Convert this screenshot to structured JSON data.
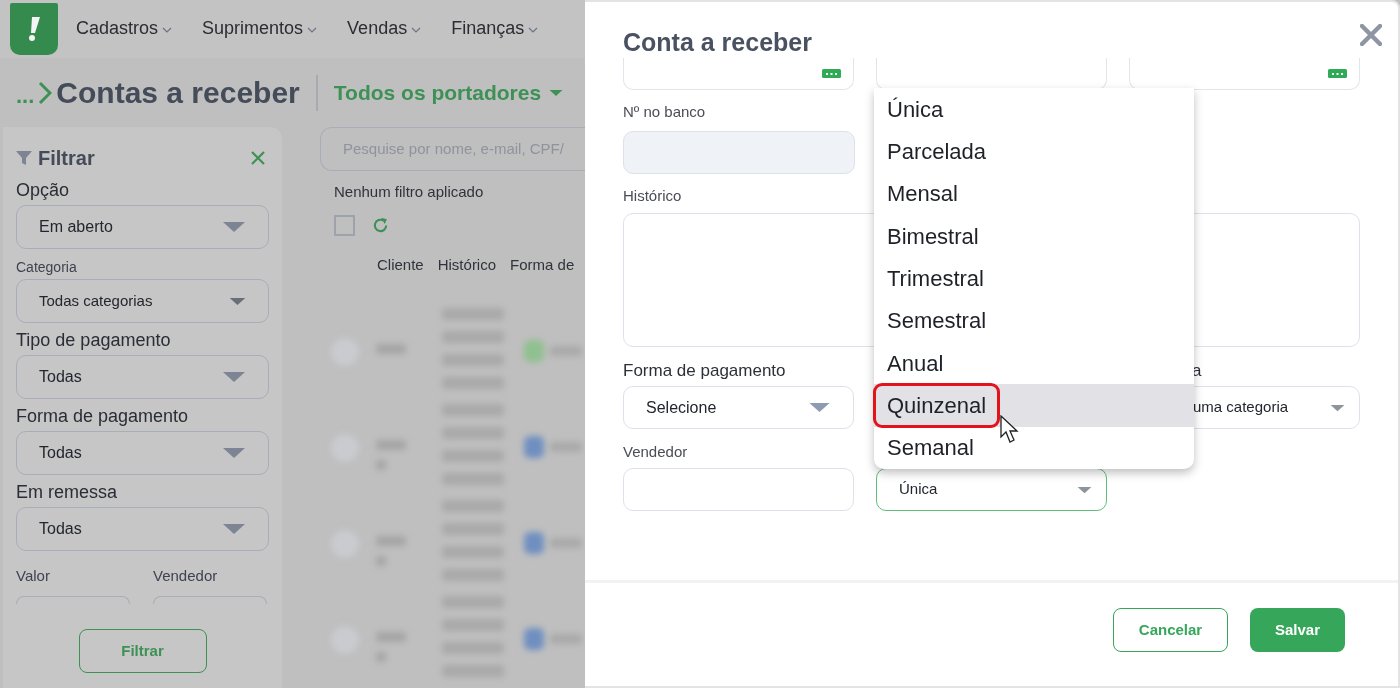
{
  "nav": {
    "items": [
      "Cadastros",
      "Suprimentos",
      "Vendas",
      "Finanças"
    ]
  },
  "page": {
    "breadcrumb": "...",
    "title": "Contas a receber",
    "portador": "Todos os portadores"
  },
  "filter": {
    "title": "Filtrar",
    "fields": [
      {
        "label": "Opção",
        "value": "Em aberto",
        "kind": "standard"
      },
      {
        "label": "Categoria",
        "value": "Todas categorias",
        "kind": "compact"
      },
      {
        "label": "Tipo de pagamento",
        "value": "Todas",
        "kind": "standard"
      },
      {
        "label": "Forma de pagamento",
        "value": "Todas",
        "kind": "standard"
      },
      {
        "label": "Em remessa",
        "value": "Todas",
        "kind": "standard"
      }
    ],
    "bottom_labels": [
      "Valor",
      "Vendedor"
    ],
    "button": "Filtrar"
  },
  "list": {
    "search_placeholder": "Pesquise por nome, e-mail, CPF/",
    "filter_status": "Nenhum filtro aplicado",
    "select_all_checked": false,
    "columns": [
      "Cliente",
      "Histórico",
      "Forma de"
    ],
    "blurred_rows": [
      {
        "color": "#8fc08f"
      },
      {
        "color": "#6f8fc0"
      },
      {
        "color": "#6f8fc0"
      },
      {
        "color": "#6f8fc0"
      }
    ]
  },
  "modal": {
    "title": "Conta a receber",
    "bank_number": {
      "label": "Nº no banco"
    },
    "history": {
      "label": "Histórico"
    },
    "payment_form": {
      "label": "Forma de pagamento",
      "value": "Selecione"
    },
    "category": {
      "label": "a",
      "value": "uma categoria"
    },
    "seller": {
      "label": "Vendedor"
    },
    "recurrence": {
      "value": "Única",
      "open": true,
      "options": [
        {
          "label": "Única",
          "highlighted": false
        },
        {
          "label": "Parcelada",
          "highlighted": false
        },
        {
          "label": "Mensal",
          "highlighted": false
        },
        {
          "label": "Bimestral",
          "highlighted": false
        },
        {
          "label": "Trimestral",
          "highlighted": false
        },
        {
          "label": "Semestral",
          "highlighted": false
        },
        {
          "label": "Anual",
          "highlighted": false
        },
        {
          "label": "Quinzenal",
          "highlighted": true
        },
        {
          "label": "Semanal",
          "highlighted": false
        }
      ]
    },
    "buttons": {
      "cancel": "Cancelar",
      "save": "Salvar"
    }
  }
}
